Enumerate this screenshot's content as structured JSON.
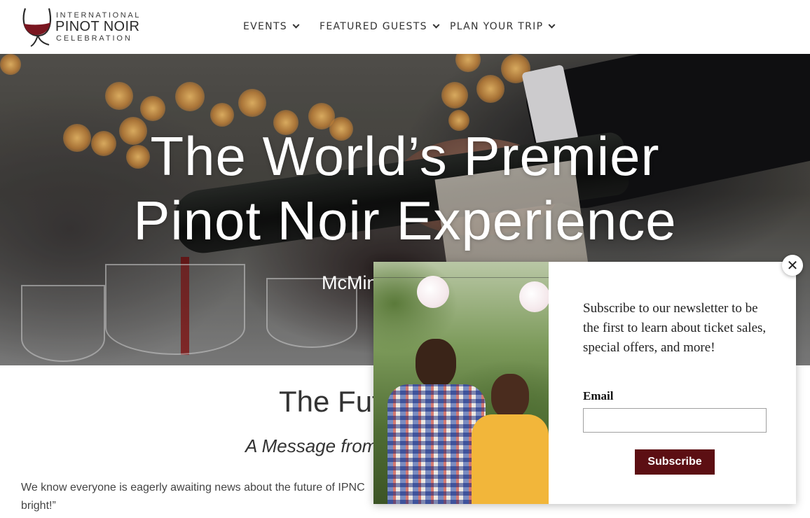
{
  "header": {
    "logo_line1": "INTERNATIONAL",
    "logo_line2": "PINOT NOIR",
    "logo_line3": "CELEBRATION",
    "nav": [
      {
        "label": "EVENTS"
      },
      {
        "label": "FEATURED GUESTS"
      },
      {
        "label": "PLAN YOUR TRIP"
      }
    ]
  },
  "hero": {
    "title_line1": "The World’s Premier",
    "title_line2": "Pinot Noir Experience",
    "subtitle": "McMin"
  },
  "content": {
    "title": "The Fut",
    "subtitle": "A Message from",
    "paragraph_line1": "We know everyone is eagerly awaiting news about the future of IPNC",
    "paragraph_line2": "bright!”"
  },
  "popup": {
    "text": "Subscribe to our newsletter to be the first to learn about ticket sales, special offers, and more!",
    "email_label": "Email",
    "email_value": "",
    "subscribe_label": "Subscribe",
    "close_glyph": "✕"
  },
  "colors": {
    "brand_wine": "#5c0f13",
    "logo_wine": "#7a1620"
  }
}
